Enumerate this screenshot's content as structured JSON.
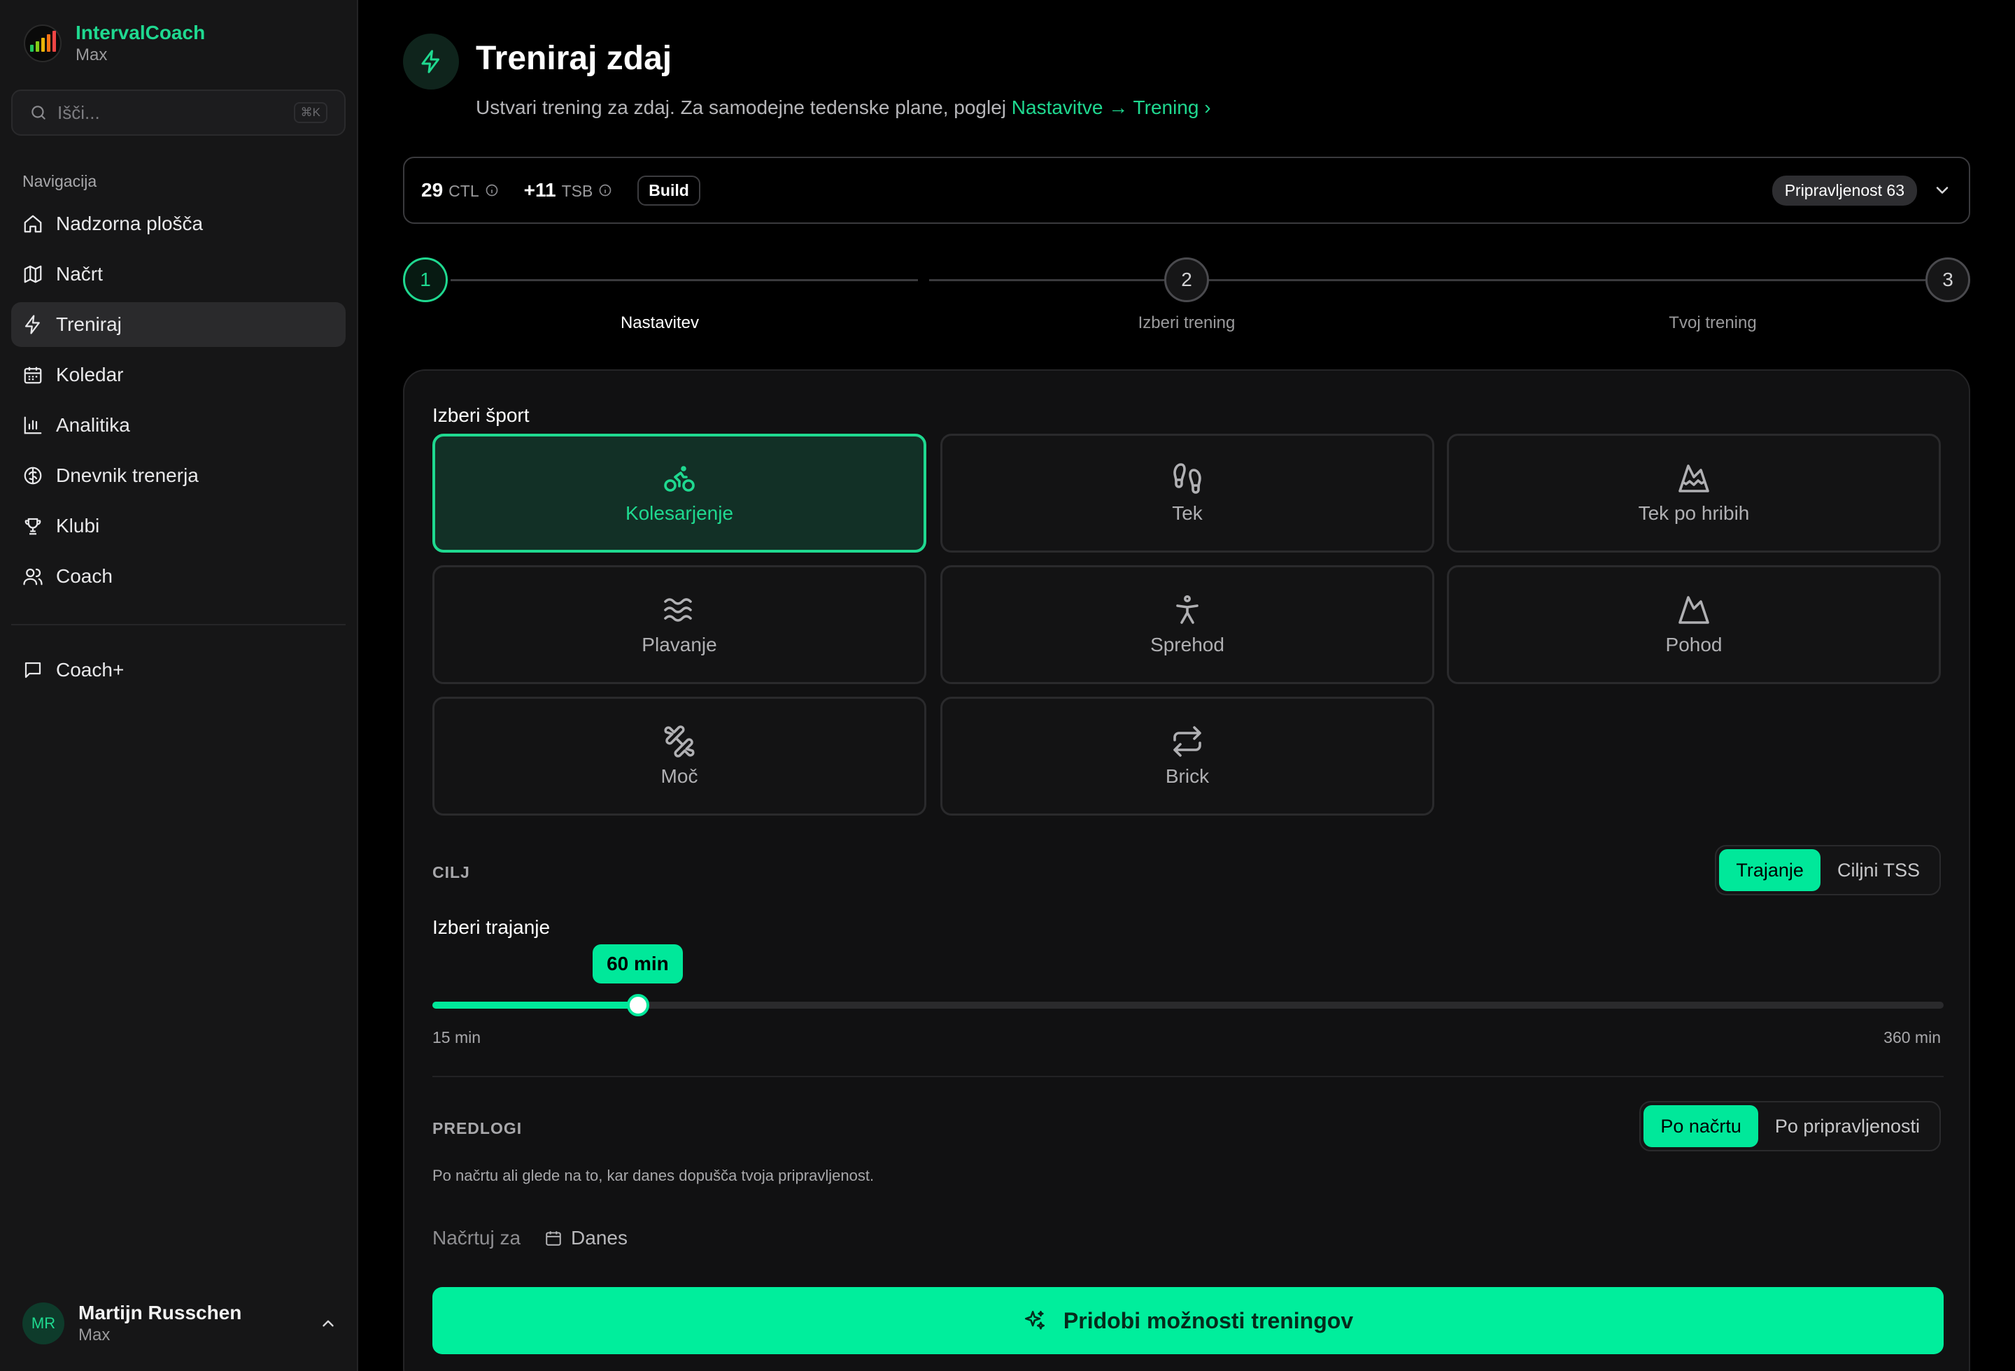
{
  "colors": {
    "accent": "#1fd990",
    "cta": "#00ee9c",
    "background": "#000000",
    "sidebar": "#161617"
  },
  "app": {
    "name": "IntervalCoach",
    "plan": "Max"
  },
  "search": {
    "placeholder": "Išči...",
    "shortcut": "⌘K"
  },
  "nav": {
    "heading": "Navigacija",
    "items": [
      {
        "label": "Nadzorna plošča",
        "icon": "home-icon"
      },
      {
        "label": "Načrt",
        "icon": "map-icon"
      },
      {
        "label": "Treniraj",
        "icon": "bolt-icon",
        "active": true
      },
      {
        "label": "Koledar",
        "icon": "calendar-icon"
      },
      {
        "label": "Analitika",
        "icon": "bar-chart-icon"
      },
      {
        "label": "Dnevnik trenerja",
        "icon": "brain-icon"
      },
      {
        "label": "Klubi",
        "icon": "trophy-icon"
      },
      {
        "label": "Coach",
        "icon": "users-icon"
      }
    ],
    "secondary": [
      {
        "label": "Coach+",
        "icon": "chat-icon"
      }
    ]
  },
  "user": {
    "initials": "MR",
    "name": "Martijn Russchen",
    "plan": "Max"
  },
  "page": {
    "title": "Treniraj zdaj",
    "subtitle": "Ustvari trening za zdaj. Za samodejne tedenske plane, poglej",
    "subtitle_link": "Nastavitve → Trening",
    "subtitle_chevron": "›"
  },
  "stats": {
    "ctl_value": "29",
    "ctl_label": "CTL",
    "tsb_value": "+11",
    "tsb_label": "TSB",
    "phase": "Build",
    "readiness": "Pripravljenost 63"
  },
  "stepper": [
    {
      "number": "1",
      "label": "Nastavitev",
      "state": "active"
    },
    {
      "number": "2",
      "label": "Izberi trening",
      "state": "todo"
    },
    {
      "number": "3",
      "label": "Tvoj trening",
      "state": "todo"
    }
  ],
  "sport": {
    "title": "Izberi šport",
    "options": [
      {
        "label": "Kolesarjenje",
        "icon": "bicycle-icon",
        "selected": true
      },
      {
        "label": "Tek",
        "icon": "footprints-icon"
      },
      {
        "label": "Tek po hribih",
        "icon": "mountain-snow-icon"
      },
      {
        "label": "Plavanje",
        "icon": "waves-icon"
      },
      {
        "label": "Sprehod",
        "icon": "person-walking-icon"
      },
      {
        "label": "Pohod",
        "icon": "mountain-icon"
      },
      {
        "label": "Moč",
        "icon": "dumbbell-icon"
      },
      {
        "label": "Brick",
        "icon": "repeat-icon"
      }
    ]
  },
  "goal": {
    "heading": "CILJ",
    "options": [
      "Trajanje",
      "Ciljni TSS"
    ],
    "selected": "Trajanje",
    "duration_title": "Izberi trajanje",
    "value_label": "60 min",
    "value": 60,
    "min": 15,
    "max": 360,
    "min_label": "15 min",
    "max_label": "360 min"
  },
  "suggestions": {
    "heading": "PREDLOGI",
    "options": [
      "Po načrtu",
      "Po pripravljenosti"
    ],
    "selected": "Po načrtu",
    "description": "Po načrtu ali glede na to, kar danes dopušča tvoja pripravljenost.",
    "plan_for_label": "Načrtuj za",
    "plan_for_value": "Danes"
  },
  "cta": {
    "label": "Pridobi možnosti treningov"
  }
}
